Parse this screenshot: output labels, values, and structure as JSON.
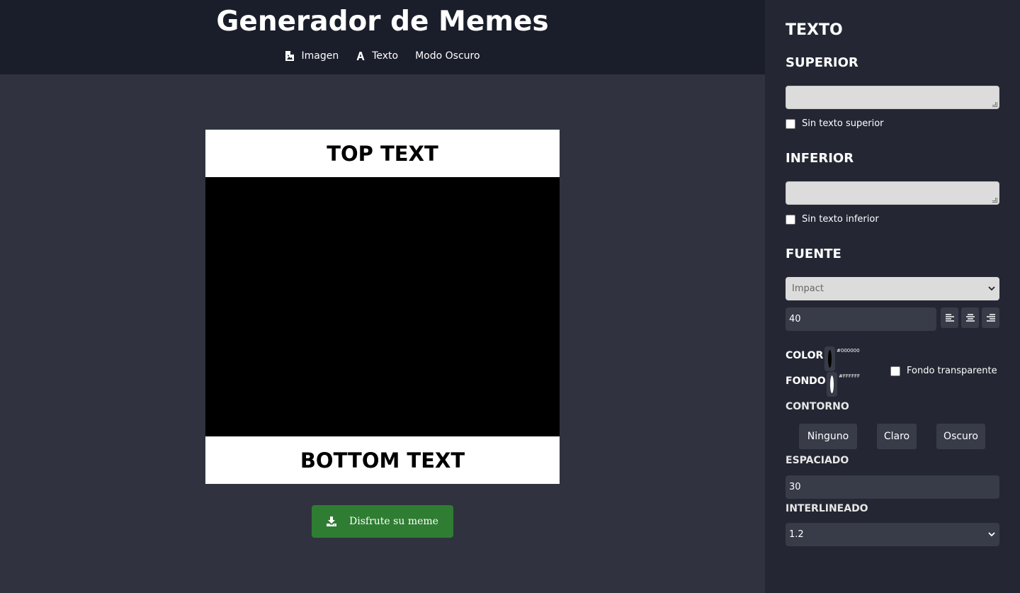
{
  "header": {
    "title": "Generador de Memes",
    "nav": [
      {
        "label": "Imagen",
        "icon": "image-file-icon"
      },
      {
        "label": "Texto",
        "icon": "font-letter-icon"
      },
      {
        "label": "Modo Oscuro",
        "icon": ""
      }
    ]
  },
  "meme": {
    "top_text": "TOP TEXT",
    "bottom_text": "BOTTOM TEXT",
    "image_color": "#000000",
    "background_color": "#FFFFFF"
  },
  "download": {
    "label": "Disfrute su meme",
    "color": "#2e7d32"
  },
  "panel": {
    "title": "TEXTO",
    "top_section": {
      "heading": "SUPERIOR",
      "value": "",
      "checkbox_label": "Sin texto superior",
      "checked": false
    },
    "bottom_section": {
      "heading": "INFERIOR",
      "value": "",
      "checkbox_label": "Sin texto inferior",
      "checked": false
    },
    "font_section": {
      "heading": "FUENTE",
      "font_family": "Impact",
      "font_size": "40"
    },
    "color": {
      "label": "COLOR",
      "value": "#000000"
    },
    "background": {
      "label": "FONDO",
      "value": "#FFFFFF",
      "transparent_label": "Fondo transparente",
      "transparent_checked": false
    },
    "outline": {
      "label": "CONTORNO",
      "options": [
        "Ninguno",
        "Claro",
        "Oscuro"
      ]
    },
    "spacing": {
      "label": "ESPACIADO",
      "value": "30"
    },
    "line_height": {
      "label": "INTERLINEADO",
      "value": "1.2"
    }
  }
}
